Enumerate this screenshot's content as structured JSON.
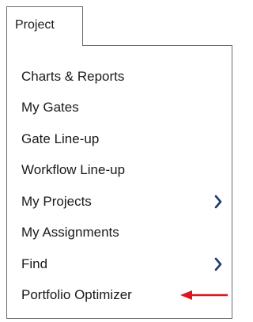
{
  "tab": {
    "label": "Project"
  },
  "menu": {
    "items": [
      {
        "label": "Charts & Reports",
        "submenu": false
      },
      {
        "label": "My Gates",
        "submenu": false
      },
      {
        "label": "Gate Line-up",
        "submenu": false
      },
      {
        "label": "Workflow Line-up",
        "submenu": false
      },
      {
        "label": "My Projects",
        "submenu": true
      },
      {
        "label": "My Assignments",
        "submenu": false
      },
      {
        "label": "Find",
        "submenu": true
      },
      {
        "label": "Portfolio Optimizer",
        "submenu": false
      }
    ]
  },
  "colors": {
    "text": "#1a1a1a",
    "border": "#6b6b6b",
    "chevron": "#1f3a6e",
    "annotation_arrow": "#e0141e"
  },
  "icons": {
    "submenu": "chevron-right-icon",
    "annotation": "red-arrow-left-icon"
  }
}
